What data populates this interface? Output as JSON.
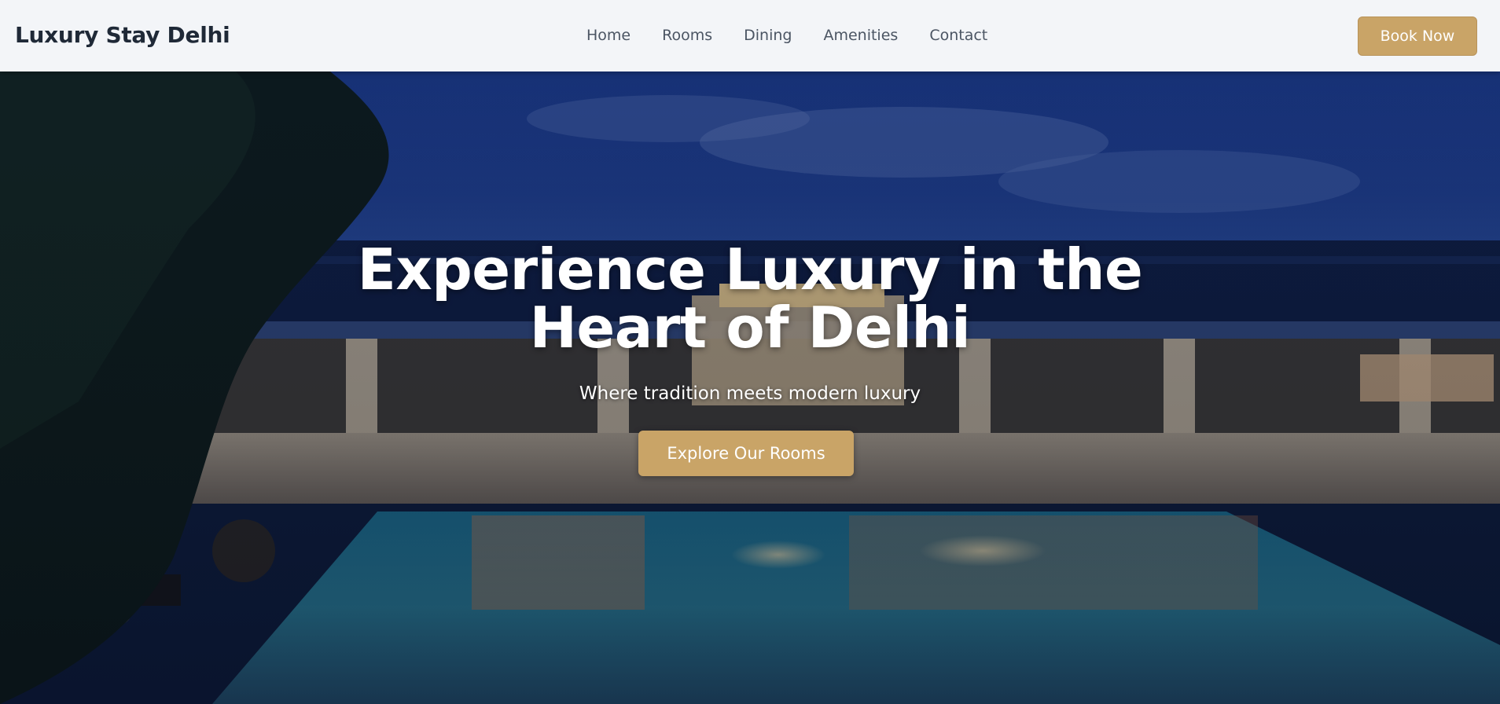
{
  "header": {
    "brand": "Luxury Stay Delhi",
    "nav": [
      "Home",
      "Rooms",
      "Dining",
      "Amenities",
      "Contact"
    ],
    "book_label": "Book Now"
  },
  "hero": {
    "title_line1": "Experience Luxury in the",
    "title_line2": "Heart of Delhi",
    "subtitle": "Where tradition meets modern luxury",
    "cta_label": "Explore Our Rooms",
    "image_desc_icon": "resort-pool-photo"
  },
  "colors": {
    "accent": "#c9a467",
    "header_bg": "#f3f5f8",
    "text_dark": "#1f2937",
    "nav_text": "#4b5563",
    "hero_text": "#ffffff"
  }
}
